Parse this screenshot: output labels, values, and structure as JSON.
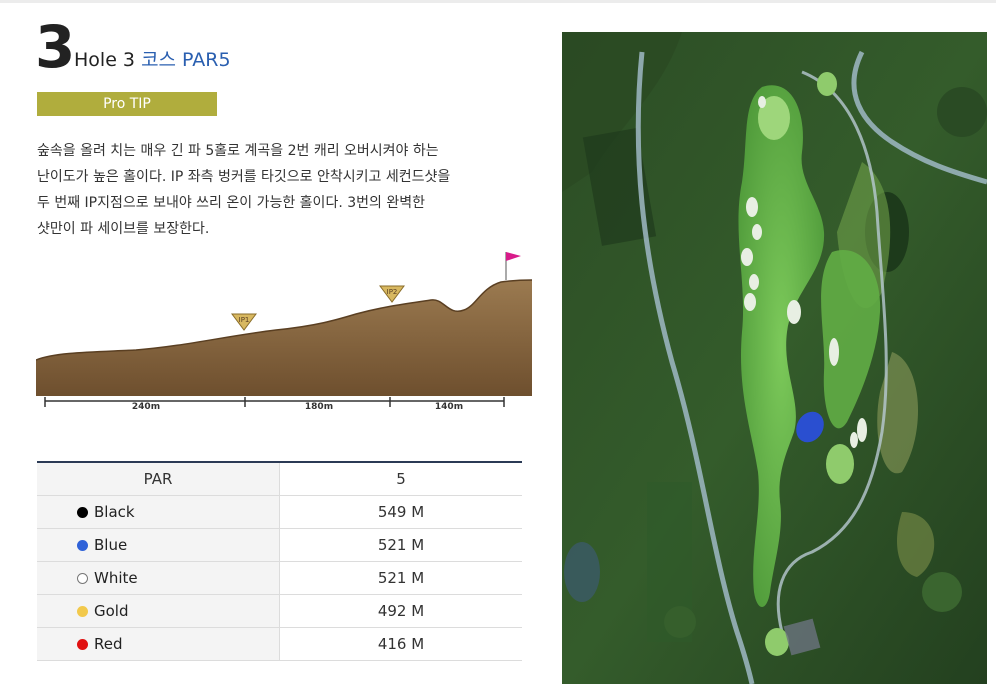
{
  "hole": {
    "number": "3",
    "label": "Hole 3",
    "course_par": "코스 PAR5"
  },
  "pro_tip_label": "Pro TIP",
  "description_lines": [
    "숲속을 올려 치는 매우 긴 파 5홀로 계곡을 2번 캐리 오버시켜야 하는",
    "난이도가 높은 홀이다. IP 좌측 벙커를 타깃으로 안착시키고 세컨드샷을",
    "두 번째 IP지점으로 보내야 쓰리 온이 가능한 홀이다. 3번의 완벽한",
    "샷만이 파 세이브를 보장한다."
  ],
  "profile": {
    "markers": [
      "IP1",
      "IP2"
    ],
    "distances": [
      "240m",
      "180m",
      "140m"
    ]
  },
  "table": {
    "header": {
      "label": "PAR",
      "value": "5"
    },
    "rows": [
      {
        "tee": "Black",
        "distance": "549 M",
        "color": "#000000"
      },
      {
        "tee": "Blue",
        "distance": "521 M",
        "color": "#2f62d8"
      },
      {
        "tee": "White",
        "distance": "521 M",
        "color": "#ffffff"
      },
      {
        "tee": "Gold",
        "distance": "492 M",
        "color": "#f2c94c"
      },
      {
        "tee": "Red",
        "distance": "416 M",
        "color": "#e01010"
      }
    ]
  },
  "colors": {
    "accent_blue": "#2a5fb0",
    "pro_tip_bg": "#b0ad3d",
    "table_top_border": "#2b3a55",
    "terrain": "#8b6a44"
  }
}
